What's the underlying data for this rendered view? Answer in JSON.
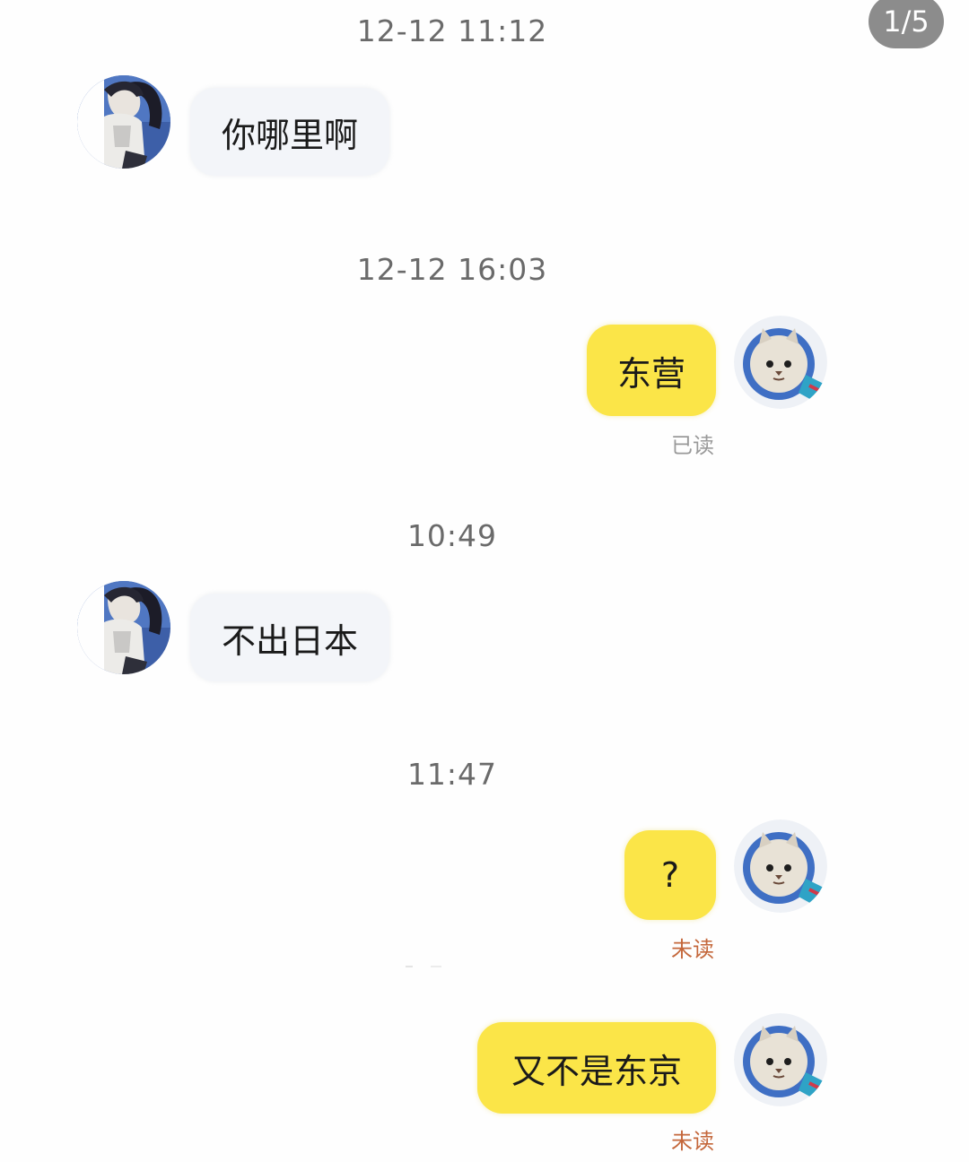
{
  "pager": {
    "label": "1/5"
  },
  "timestamps": [
    "12-12 11:12",
    "12-12 16:03",
    "10:49",
    "11:47"
  ],
  "messages": [
    {
      "side": "in",
      "text": "你哪里啊"
    },
    {
      "side": "out",
      "text": "东营",
      "status": "已读"
    },
    {
      "side": "in",
      "text": "不出日本"
    },
    {
      "side": "out",
      "text": "?",
      "status": "未读"
    },
    {
      "side": "out",
      "text": "又不是东京",
      "status": "未读"
    }
  ],
  "colors": {
    "incoming_bubble": "#f3f5f9",
    "outgoing_bubble": "#fbe548",
    "read_status": "#9a9a9a",
    "unread_status": "#c4673b",
    "timestamp": "#6a6a6a"
  },
  "avatars": {
    "contact": "anime-character-avatar-icon",
    "self": "cat-astronaut-avatar-icon"
  }
}
